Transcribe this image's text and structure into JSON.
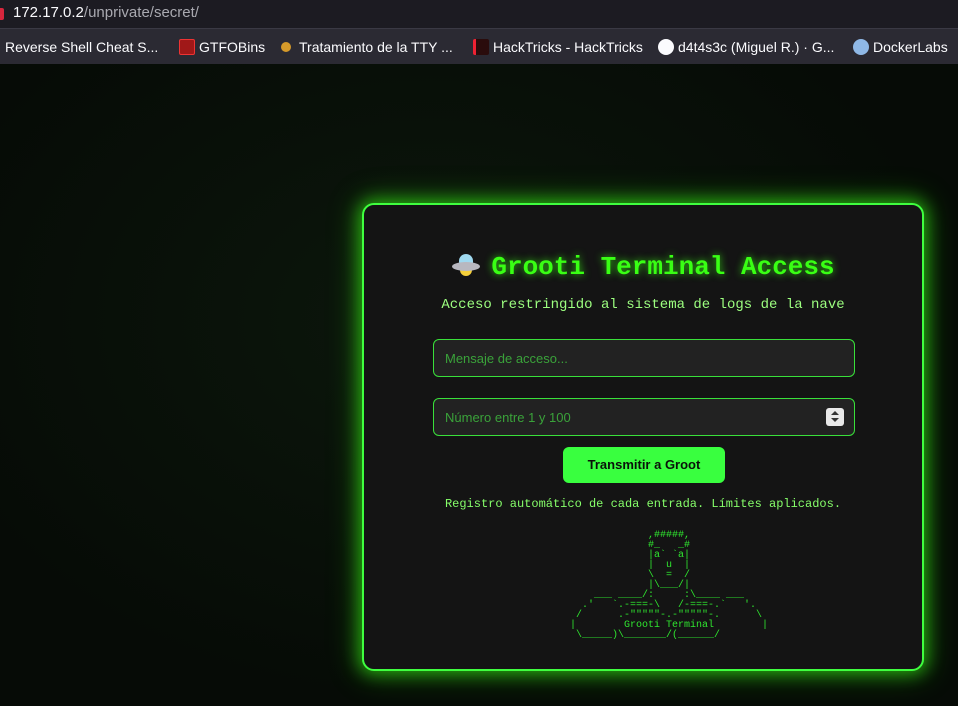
{
  "browser": {
    "url_host": "172.17.0.2",
    "url_path": "/unprivate/secret/",
    "bookmarks": [
      {
        "label": "Reverse Shell Cheat S...",
        "icon": "none"
      },
      {
        "label": "GTFOBins",
        "icon": "gtfobins-icon"
      },
      {
        "label": "Tratamiento de la TTY ...",
        "icon": "tty-icon"
      },
      {
        "label": "HackTricks - HackTricks",
        "icon": "hacktricks-icon"
      },
      {
        "label": "d4t4s3c (Miguel R.) · G...",
        "icon": "github-icon"
      },
      {
        "label": "DockerLabs",
        "icon": "dockerlabs-icon"
      }
    ]
  },
  "card": {
    "title": "Grooti Terminal Access",
    "title_icon": "ufo-icon",
    "subtitle": "Acceso restringido al sistema de logs de la nave",
    "message_placeholder": "Mensaje de acceso...",
    "number_placeholder": "Número entre 1 y 100",
    "submit_label": "Transmitir a Groot",
    "note": "Registro automático de cada entrada. Límites aplicados.",
    "ascii_art": "              ,#####,\n              #_   _#\n              |a` `a|\n              |  u  |\n              \\  =  /\n              |\\___/|\n     ___ ____/:     :\\____ ___\n   .'   `.-===-\\   /-===-.`   '.\n  /      .-\"\"\"\"\"-.-\"\"\"\"\"-.      \\\n |        Grooti Terminal        |\n  \\_____)\\_______/(______/"
  },
  "colors": {
    "accent": "#39ff14",
    "card_bg": "#141414",
    "page_bg": "#070d07"
  }
}
